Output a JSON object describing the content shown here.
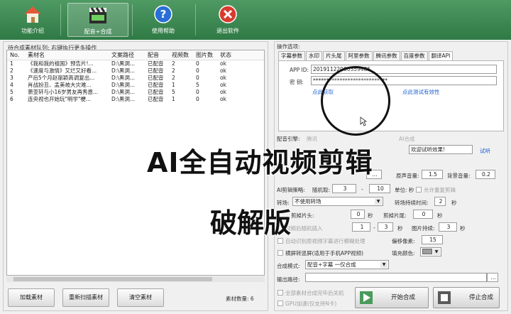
{
  "toolbar": {
    "items": [
      {
        "label": "功能介绍",
        "icon": "home-icon"
      },
      {
        "label": "配音+合成",
        "icon": "clapperboard-icon"
      },
      {
        "label": "使用帮助",
        "icon": "help-icon"
      },
      {
        "label": "退出软件",
        "icon": "exit-icon"
      }
    ]
  },
  "queue": {
    "title": "待合成素材队列: 右键执行更多操作",
    "columns": [
      "No.",
      "素材名",
      "文案路径",
      "配音",
      "视频数",
      "图片数",
      "状态"
    ],
    "rows": [
      [
        "1",
        "《我和我的祖国》预告片!...",
        "D:\\黑洞...",
        "已配音",
        "2",
        "0",
        "ok"
      ],
      [
        "2",
        "《速度与激情》又烂又好看...",
        "D:\\黑洞...",
        "已配音",
        "2",
        "0",
        "ok"
      ],
      [
        "3",
        "产后5个月赵丽颖高调复出...",
        "D:\\黑洞...",
        "已配音",
        "2",
        "0",
        "ok"
      ],
      [
        "4",
        "肖战扮丑、孟美岐大灾难...",
        "D:\\黑洞...",
        "已配音",
        "1",
        "5",
        "ok"
      ],
      [
        "5",
        "萧亚轩与小16岁男友再秀恩...",
        "D:\\黑洞...",
        "已配音",
        "5",
        "0",
        "ok"
      ],
      [
        "6",
        "连央视也开始玩\"明学\"梗...",
        "D:\\黑洞...",
        "已配音",
        "1",
        "0",
        "ok"
      ]
    ],
    "buttons": {
      "load": "加载素材",
      "rescan": "重新扫描素材",
      "clear": "清空素材"
    },
    "count_label": "素材数量: 6"
  },
  "options": {
    "title": "操作选项:",
    "tabs": [
      "字幕参数",
      "水印",
      "片头尾",
      "阿里参数",
      "腾讯参数",
      "百度参数",
      "翻译API"
    ],
    "selected_tab": "翻译API",
    "app_id_label": "APP ID:",
    "app_id_value": "20191122000359485",
    "key_label": "密  钥:",
    "key_value": "****************************",
    "link_register": "点此获取",
    "link_test": "点此测试有效性",
    "voice_engine_label": "配音引擎:",
    "voice_engine_option_1": "腾讯",
    "voice_engine_option_2": "AI合成",
    "preview_text": "欢迎试听效果!",
    "preview_link": "试听",
    "bg_volume_label": "背景音量:",
    "bg_volume_value": "0.2",
    "main_volume_label": "原声音量:",
    "main_volume_value": "1.5",
    "speech_params_label": "AI剪辑策略:",
    "random_extract_label": "随机取:",
    "random_from": "3",
    "random_sep": "-",
    "random_to": "10",
    "random_unit": "单位: 秒",
    "allow_dup_label": "允许重复剪辑",
    "transition_label": "转场:",
    "transition_value": "不使用转场",
    "transition_duration_label": "转场持续时间:",
    "transition_duration_value": "2",
    "sec": "秒",
    "cut_head_label": "剪掉片头:",
    "cut_head_value": "0",
    "cut_tail_label": "剪掉片尾:",
    "cut_tail_value": "0",
    "video_random_label": "视频后随机插入",
    "video_random_from": "1",
    "video_random_to": "3",
    "image_duration_label": "图片持续:",
    "image_duration_value": "3",
    "auto_blur_label": "自动识别原视频字幕进行模糊处理",
    "offset_label": "偏移像素:",
    "offset_value": "15",
    "landscape_label": "横屏转竖屏(适用于手机APP视频)",
    "fill_color_label": "填充颜色:",
    "compose_mode_label": "合成模式:",
    "compose_mode_value": "配音+字幕 一仅合成",
    "output_path_label": "输出路径:",
    "shutdown_label": "全部素材合成完毕后关机",
    "gpu_label": "GPU加速(仅支持N卡)",
    "start_button": "开始合成",
    "stop_button": "停止合成"
  },
  "overlay": {
    "line1": "AI全自动视频剪辑",
    "line2": "破解版"
  }
}
